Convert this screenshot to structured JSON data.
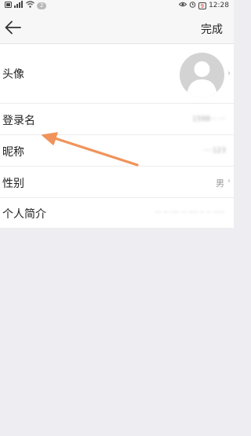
{
  "status_bar": {
    "left_icons": [
      "sim-icon",
      "signal-icon",
      "wifi-icon"
    ],
    "notification_count": "2",
    "battery": "9",
    "time": "12:28"
  },
  "header": {
    "back_icon": "arrow-left-icon",
    "done_label": "完成"
  },
  "profile": {
    "avatar": {
      "label": "头像",
      "icon": "default-avatar-icon"
    },
    "username": {
      "label": "登录名",
      "value": "1598··· ···"
    },
    "nickname": {
      "label": "昵称",
      "value": "····123"
    },
    "gender": {
      "label": "性别",
      "value": "男"
    },
    "bio": {
      "label": "个人简介",
      "value": "··· ·· ···· ·· ···· ·· ·· ·····"
    }
  },
  "colors": {
    "annotation_arrow": "#f0935a",
    "background": "#eeedf2",
    "row_background": "#ffffff"
  }
}
